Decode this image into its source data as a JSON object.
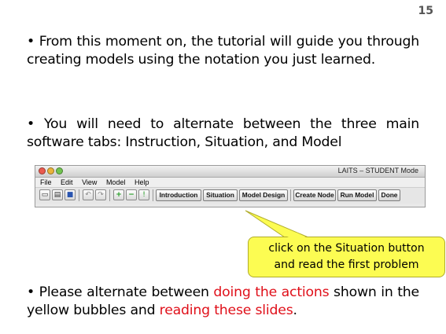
{
  "slide": {
    "page_number": "15",
    "para1": "• From this moment on, the tutorial will guide you through creating models using the notation you just learned.",
    "para2": "• You will need to alternate between the three main software tabs: Instruction, Situation, and Model",
    "para3_part1": "• Please alternate between ",
    "para3_red1": "doing the actions",
    "para3_part2": " shown in the yellow bubbles and ",
    "para3_red2": "reading these slides",
    "para3_part3": "."
  },
  "app_window": {
    "title": "LAITS – STUDENT Mode",
    "menus": [
      "File",
      "Edit",
      "View",
      "Model",
      "Help"
    ],
    "toolbar_buttons": {
      "introduction": "Introduction",
      "situation": "Situation",
      "model_design": "Model Design",
      "create_node": "Create Node",
      "run_model": "Run Model",
      "done": "Done"
    },
    "icons": [
      "new-file-icon",
      "open-folder-icon",
      "save-icon",
      "undo-icon",
      "redo-icon",
      "add-node-icon",
      "remove-node-icon",
      "info-icon"
    ]
  },
  "callout": {
    "line1": "click on the Situation button",
    "line2": "and read the first problem",
    "fill_color": "#fcfc52"
  },
  "colors": {
    "highlight_red": "#e0101a"
  }
}
